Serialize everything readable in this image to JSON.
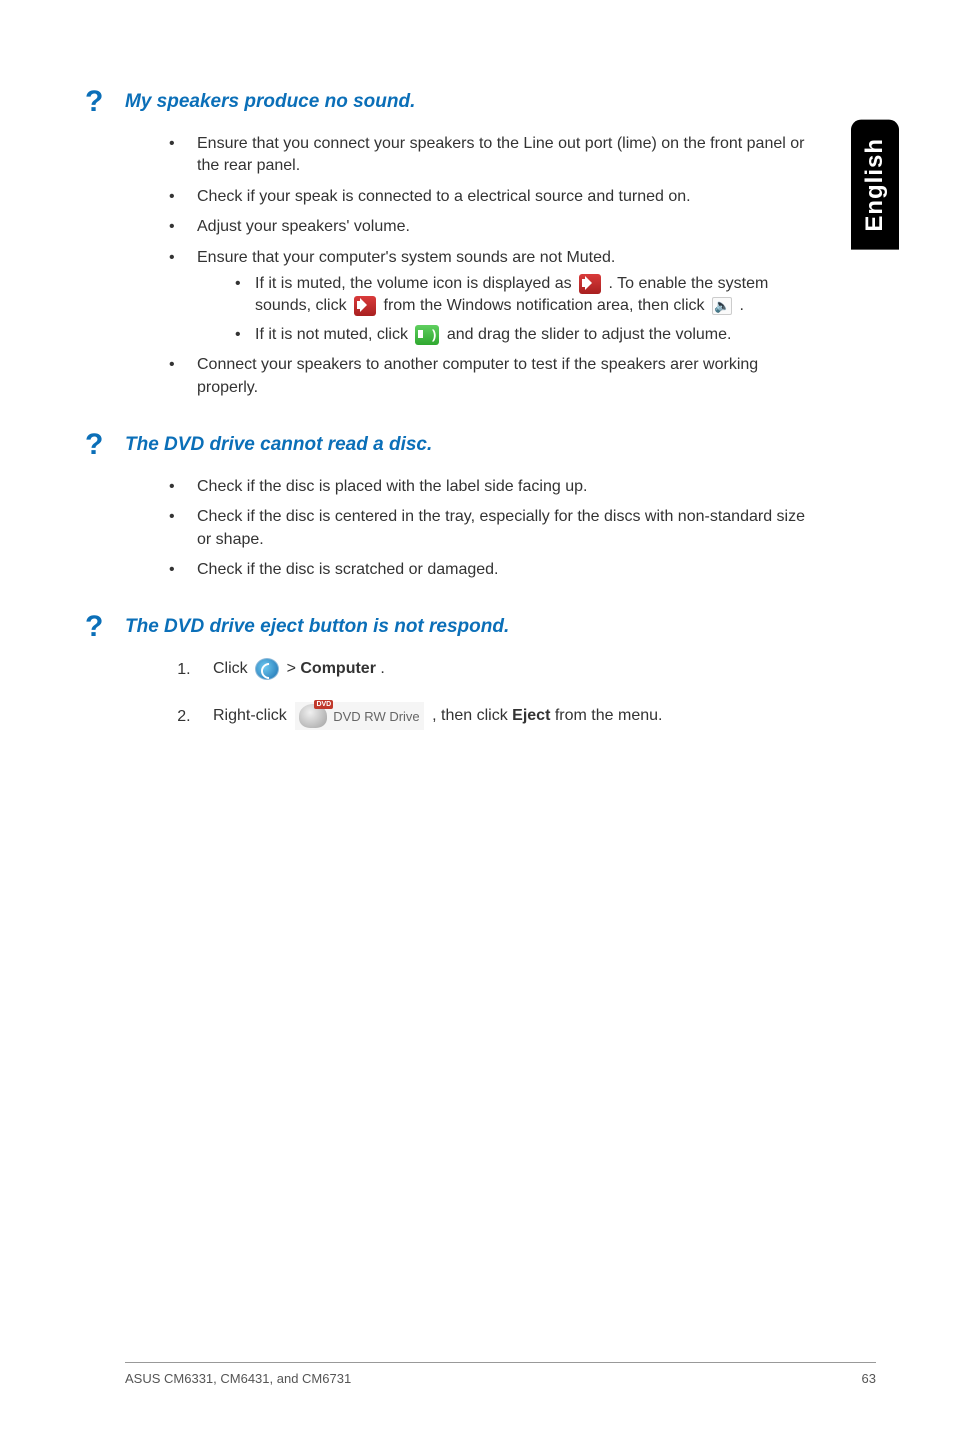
{
  "lang_tab": "English",
  "sections": [
    {
      "q": "?",
      "title": "My speakers produce no sound.",
      "bullets": [
        "Ensure that you connect your speakers to the Line out port (lime) on the front panel or the rear panel.",
        "Check if your speak is connected to a electrical source and turned on.",
        "Adjust your speakers' volume.",
        "Ensure that your computer's system sounds are not Muted.",
        "Connect your speakers to another computer to test if the speakers arer working properly."
      ],
      "sub_bullets": {
        "muted_pre": "If it is muted, the volume icon is displayed as ",
        "muted_mid": " . To enable the system sounds, click ",
        "muted_post1": " from the Windows notification area, then click ",
        "muted_post2": " .",
        "not_muted_pre": "If it is not muted, click ",
        "not_muted_post": " and drag the slider to adjust the volume."
      }
    },
    {
      "q": "?",
      "title": "The DVD drive cannot read a disc.",
      "bullets": [
        "Check if the disc is placed with the label side facing up.",
        "Check if the disc is centered in the tray, especially for the discs with non-standard size or shape.",
        "Check if the disc is scratched or damaged."
      ]
    },
    {
      "q": "?",
      "title": "The DVD drive eject button is not respond.",
      "steps": {
        "s1_pre": "Click ",
        "s1_post": " > ",
        "s1_bold": "Computer",
        "s1_end": ".",
        "s2_pre": "Right-click ",
        "s2_mid": ", then click ",
        "s2_bold": "Eject",
        "s2_post": " from the menu.",
        "dvd_label": "DVD RW Drive"
      }
    }
  ],
  "footer_left": "ASUS CM6331, CM6431, and CM6731",
  "footer_right": "63"
}
